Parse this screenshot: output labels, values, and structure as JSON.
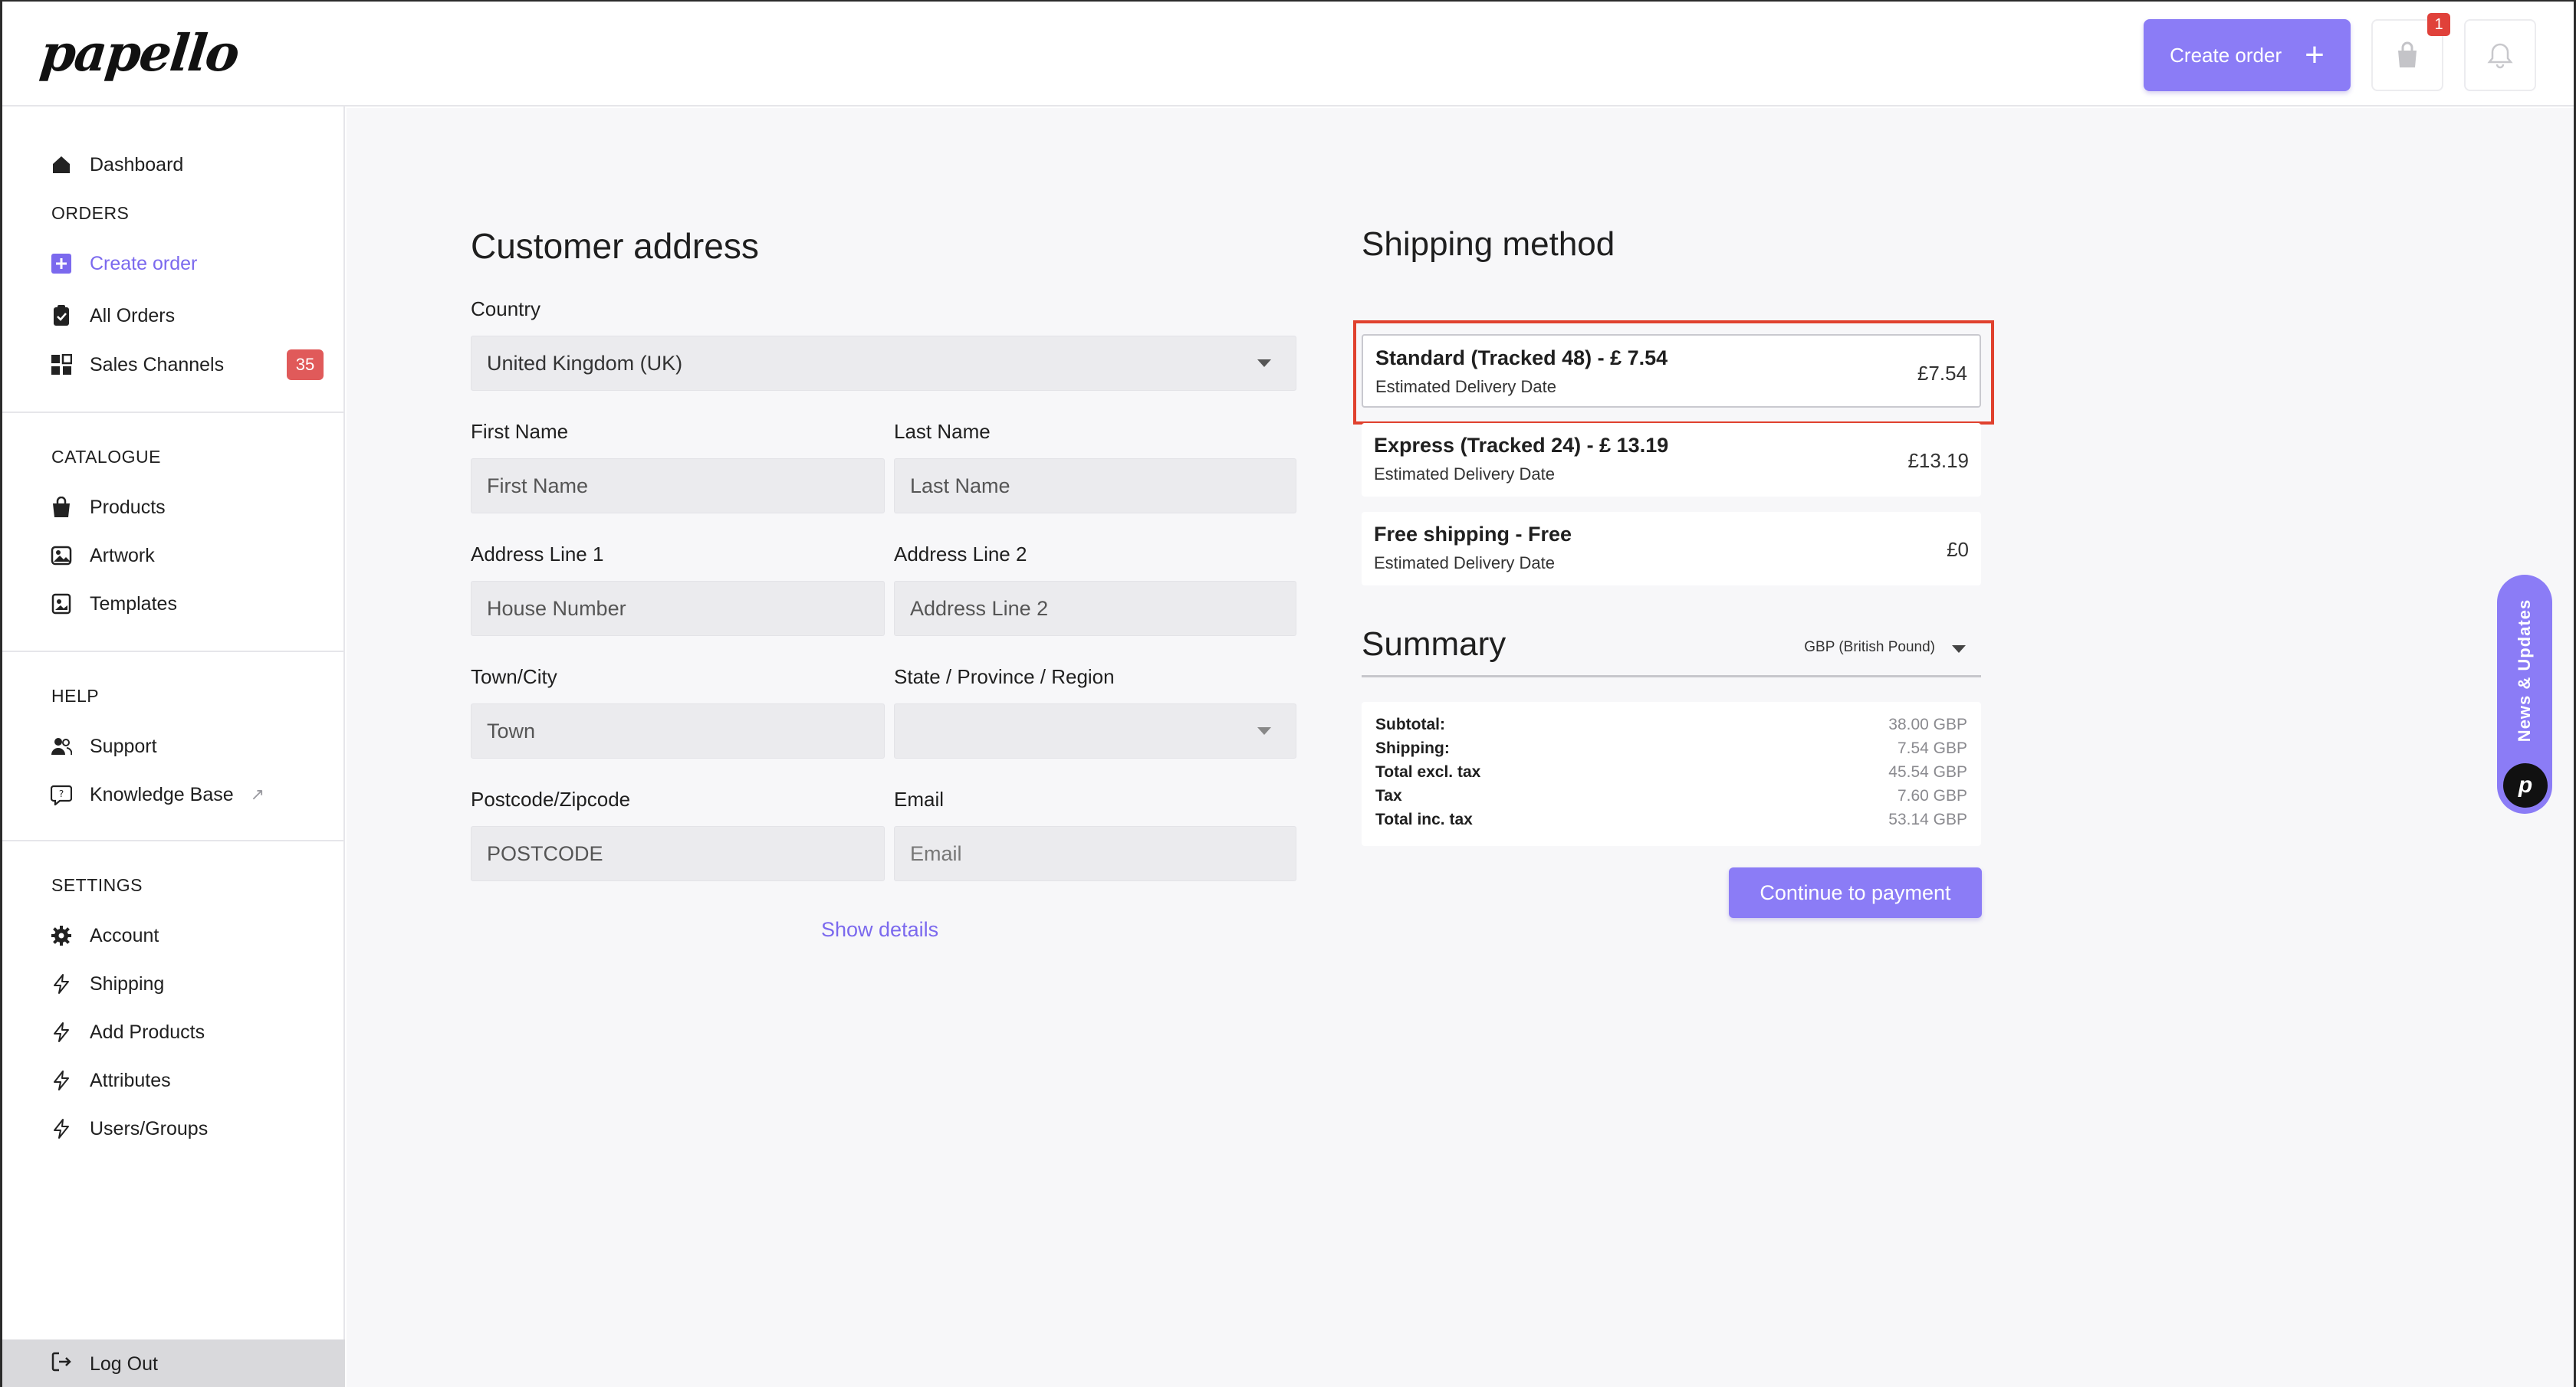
{
  "app": {
    "logo_text": "papello"
  },
  "header": {
    "create_order_label": "Create order",
    "cart_badge": "1"
  },
  "sidebar": {
    "dashboard": "Dashboard",
    "orders_heading": "ORDERS",
    "create_order": "Create order",
    "all_orders": "All Orders",
    "sales_channels": "Sales Channels",
    "sales_channels_badge": "35",
    "catalogue_heading": "CATALOGUE",
    "products": "Products",
    "artwork": "Artwork",
    "templates": "Templates",
    "help_heading": "HELP",
    "support": "Support",
    "knowledge_base": "Knowledge Base",
    "settings_heading": "SETTINGS",
    "account": "Account",
    "shipping": "Shipping",
    "add_products": "Add Products",
    "attributes": "Attributes",
    "users_groups": "Users/Groups",
    "log_out": "Log Out"
  },
  "address": {
    "title": "Customer address",
    "country_label": "Country",
    "country_value": "United Kingdom (UK)",
    "first_name_label": "First Name",
    "first_name_placeholder": "First Name",
    "last_name_label": "Last Name",
    "last_name_placeholder": "Last Name",
    "address1_label": "Address Line 1",
    "address1_placeholder": "House Number",
    "address2_label": "Address Line 2",
    "address2_placeholder": "Address Line 2",
    "town_label": "Town/City",
    "town_placeholder": "Town",
    "state_label": "State / Province / Region",
    "state_value": "",
    "postcode_label": "Postcode/Zipcode",
    "postcode_placeholder": "POSTCODE",
    "email_label": "Email",
    "email_placeholder": "Email",
    "show_details": "Show details"
  },
  "shipping": {
    "title": "Shipping method",
    "options": [
      {
        "title": "Standard (Tracked 48) - £ 7.54",
        "sub": "Estimated Delivery Date",
        "price": "£7.54",
        "selected": true
      },
      {
        "title": "Express (Tracked 24) - £ 13.19",
        "sub": "Estimated Delivery Date",
        "price": "£13.19",
        "selected": false
      },
      {
        "title": "Free shipping - Free",
        "sub": "Estimated Delivery Date",
        "price": "£0",
        "selected": false
      }
    ]
  },
  "summary": {
    "title": "Summary",
    "currency": "GBP (British Pound)",
    "rows": [
      {
        "label": "Subtotal:",
        "value": "38.00 GBP"
      },
      {
        "label": "Shipping:",
        "value": "7.54 GBP"
      },
      {
        "label": "Total excl. tax",
        "value": "45.54 GBP"
      },
      {
        "label": "Tax",
        "value": "7.60 GBP"
      },
      {
        "label": "Total inc. tax",
        "value": "53.14 GBP"
      }
    ],
    "continue_label": "Continue to payment"
  },
  "news_tab": {
    "label": "News & Updates"
  },
  "colors": {
    "accent": "#8b7cf6",
    "badge_red": "#e05a5a",
    "highlight_red": "#e0412e"
  }
}
